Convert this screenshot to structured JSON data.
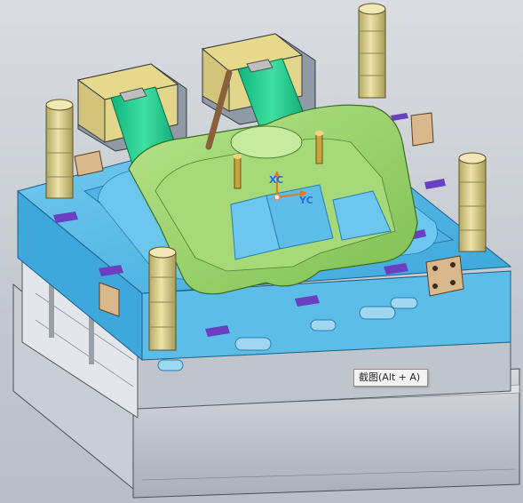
{
  "tooltip": {
    "text": "截图(Alt + A)"
  },
  "axes": {
    "xc_label": "XC",
    "yc_label": "YC"
  },
  "colors": {
    "mold_blue": "#4fb6e4",
    "core_green": "#9bd36a",
    "slider_green": "#1ec58a",
    "block_yellow": "#e2d68a",
    "pillar_tan": "#d8cc8a",
    "pad_purple": "#6a3fc0",
    "base_grey": "#b7bdc4"
  },
  "icons": [
    "xc-axis-arrow-icon",
    "yc-axis-arrow-icon",
    "wcs-origin-icon"
  ]
}
